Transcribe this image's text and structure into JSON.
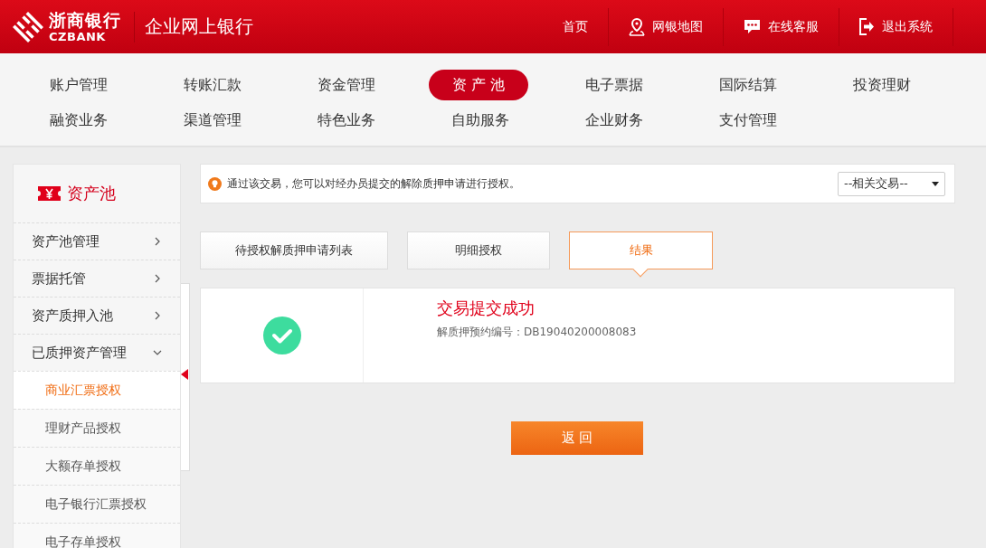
{
  "header": {
    "logo": {
      "name": "浙商银行",
      "latin": "CZBANK"
    },
    "title": "企业网上银行",
    "links": [
      {
        "label": "首页",
        "kind": "text"
      },
      {
        "label": "网银地图",
        "kind": "map"
      },
      {
        "label": "在线客服",
        "kind": "chat"
      },
      {
        "label": "退出系统",
        "kind": "exit"
      }
    ]
  },
  "nav": {
    "rows": [
      [
        {
          "label": "账户管理",
          "selected": false
        },
        {
          "label": "转账汇款",
          "selected": false
        },
        {
          "label": "资金管理",
          "selected": false
        },
        {
          "label": "资 产 池",
          "selected": true
        },
        {
          "label": "电子票据",
          "selected": false
        },
        {
          "label": "国际结算",
          "selected": false
        },
        {
          "label": "投资理财",
          "selected": false
        }
      ],
      [
        {
          "label": "融资业务",
          "selected": false
        },
        {
          "label": "渠道管理",
          "selected": false
        },
        {
          "label": "特色业务",
          "selected": false
        },
        {
          "label": "自助服务",
          "selected": false
        },
        {
          "label": "企业财务",
          "selected": false
        },
        {
          "label": "支付管理",
          "selected": false
        }
      ]
    ]
  },
  "sidebar": {
    "title": "资产池",
    "items": [
      {
        "label": "资产池管理",
        "expanded": false
      },
      {
        "label": "票据托管",
        "expanded": false
      },
      {
        "label": "资产质押入池",
        "expanded": false
      },
      {
        "label": "已质押资产管理",
        "expanded": true,
        "children": [
          {
            "label": "商业汇票授权",
            "selected": true
          },
          {
            "label": "理财产品授权",
            "selected": false
          },
          {
            "label": "大额存单授权",
            "selected": false
          },
          {
            "label": "电子银行汇票授权",
            "selected": false
          },
          {
            "label": "电子存单授权",
            "selected": false
          }
        ]
      }
    ]
  },
  "notice": {
    "text": "通过该交易，您可以对经办员提交的解除质押申请进行授权。",
    "dropdown": {
      "value": "--相关交易--"
    }
  },
  "steps": [
    {
      "label": "待授权解质押申请列表",
      "selected": false
    },
    {
      "label": "明细授权",
      "selected": false
    },
    {
      "label": "结果",
      "selected": true
    }
  ],
  "result": {
    "title": "交易提交成功",
    "reference": "解质押预约编号：DB19040200008083"
  },
  "button": {
    "label": "返 回"
  }
}
